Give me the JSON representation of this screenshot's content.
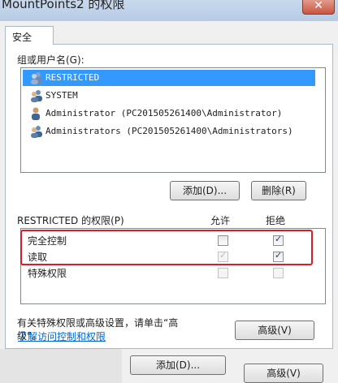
{
  "window": {
    "title": "MountPoints2 的权限",
    "close_symbol": "✕"
  },
  "tabs": [
    {
      "label": "安全"
    }
  ],
  "security": {
    "group_label": "组或用户名(G):",
    "users": [
      {
        "name": "RESTRICTED",
        "selected": true,
        "icon": "group-user-icon"
      },
      {
        "name": "SYSTEM",
        "selected": false,
        "icon": "group-user-icon"
      },
      {
        "name": "Administrator (PC201505261400\\Administrator)",
        "selected": false,
        "icon": "single-user-icon"
      },
      {
        "name": "Administrators (PC201505261400\\Administrators)",
        "selected": false,
        "icon": "group-user-icon"
      }
    ],
    "add_button": "添加(D)...",
    "remove_button": "删除(R)",
    "permissions_label": "RESTRICTED 的权限(P)",
    "allow_header": "允许",
    "deny_header": "拒绝",
    "permissions": [
      {
        "name": "完全控制",
        "allow": false,
        "deny": true,
        "allow_disabled": false,
        "deny_disabled": false
      },
      {
        "name": "读取",
        "allow": true,
        "deny": true,
        "allow_disabled": true,
        "deny_disabled": false
      },
      {
        "name": "特殊权限",
        "allow": false,
        "deny": false,
        "allow_disabled": true,
        "deny_disabled": true
      }
    ],
    "advanced_hint_line1": "有关特殊权限或高级设置，请单击“高",
    "advanced_hint_line2": "级”。",
    "advanced_button": "高级(V)",
    "access_link": "了解访问控制和权限"
  },
  "bottom": {
    "add_button": "添加(D)...",
    "advanced_button": "高级(V)"
  },
  "colors": {
    "highlight": "#3399ff",
    "annotation_red": "#d81e2a",
    "link": "#0066cc"
  }
}
